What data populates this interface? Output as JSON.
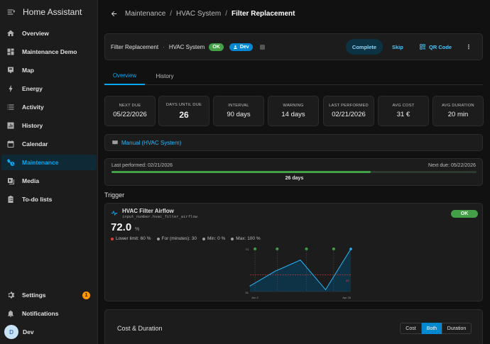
{
  "app": {
    "title": "Home Assistant"
  },
  "sidebar": {
    "items": [
      {
        "label": "Overview",
        "icon": "home-icon"
      },
      {
        "label": "Maintenance Demo",
        "icon": "dashboard-icon"
      },
      {
        "label": "Map",
        "icon": "map-icon"
      },
      {
        "label": "Energy",
        "icon": "lightning-icon"
      },
      {
        "label": "Activity",
        "icon": "list-icon"
      },
      {
        "label": "History",
        "icon": "chart-box-icon"
      },
      {
        "label": "Calendar",
        "icon": "calendar-icon"
      },
      {
        "label": "Maintenance",
        "icon": "wrench-clock-icon"
      },
      {
        "label": "Media",
        "icon": "media-icon"
      },
      {
        "label": "To-do lists",
        "icon": "clipboard-list-icon"
      }
    ],
    "settings": {
      "label": "Settings",
      "badge": "1"
    },
    "notifications": {
      "label": "Notifications"
    },
    "user": {
      "label": "Dev",
      "initial": "D"
    }
  },
  "breadcrumb": {
    "a": "Maintenance",
    "b": "HVAC System",
    "c": "Filter Replacement"
  },
  "header": {
    "task": "Filter Replacement",
    "object": "HVAC System",
    "status": "OK",
    "user": "Dev",
    "complete": "Complete",
    "skip": "Skip",
    "qr": "QR Code"
  },
  "tabs": {
    "overview": "Overview",
    "history": "History"
  },
  "stats": [
    {
      "label": "NEXT DUE",
      "value": "05/22/2026"
    },
    {
      "label": "DAYS UNTIL DUE",
      "value": "26"
    },
    {
      "label": "INTERVAL",
      "value": "90 days"
    },
    {
      "label": "WARNING",
      "value": "14 days"
    },
    {
      "label": "LAST PERFORMED",
      "value": "02/21/2026"
    },
    {
      "label": "AVG COST",
      "value": "31 €"
    },
    {
      "label": "AVG DURATION",
      "value": "20 min"
    }
  ],
  "manual": {
    "label": "Manual (HVAC System)"
  },
  "progress": {
    "last": "Last performed: 02/21/2026",
    "next": "Next due: 05/22/2026",
    "days": "26 days",
    "fraction": 0.71
  },
  "trigger": {
    "section_title": "Trigger",
    "name": "HVAC Filter Airflow",
    "entity": "input_number.hvac_filter_airflow",
    "value": "72.0",
    "unit": "%",
    "status": "OK",
    "lower_limit": "Lower limit: 60 %",
    "for_minutes": "For (minutes): 30",
    "min": "Min: 0 %",
    "max": "Max: 100 %"
  },
  "chart_data": {
    "type": "line",
    "series": [
      {
        "values": [
          54,
          62,
          68,
          52,
          74
        ]
      }
    ],
    "y_top_label": "74",
    "y_bottom_label": "51",
    "threshold_label": "60",
    "x_start_label": "Jun 2",
    "x_end_label": "Apr 26",
    "ylim": [
      51,
      74
    ],
    "threshold": 60
  },
  "cost": {
    "title": "Cost & Duration",
    "seg_cost": "Cost",
    "seg_both": "Both",
    "seg_duration": "Duration"
  },
  "colors": {
    "accent": "#03a9f4",
    "ok": "#43a047",
    "warning": "#ff9800",
    "threshold": "#e53935"
  }
}
